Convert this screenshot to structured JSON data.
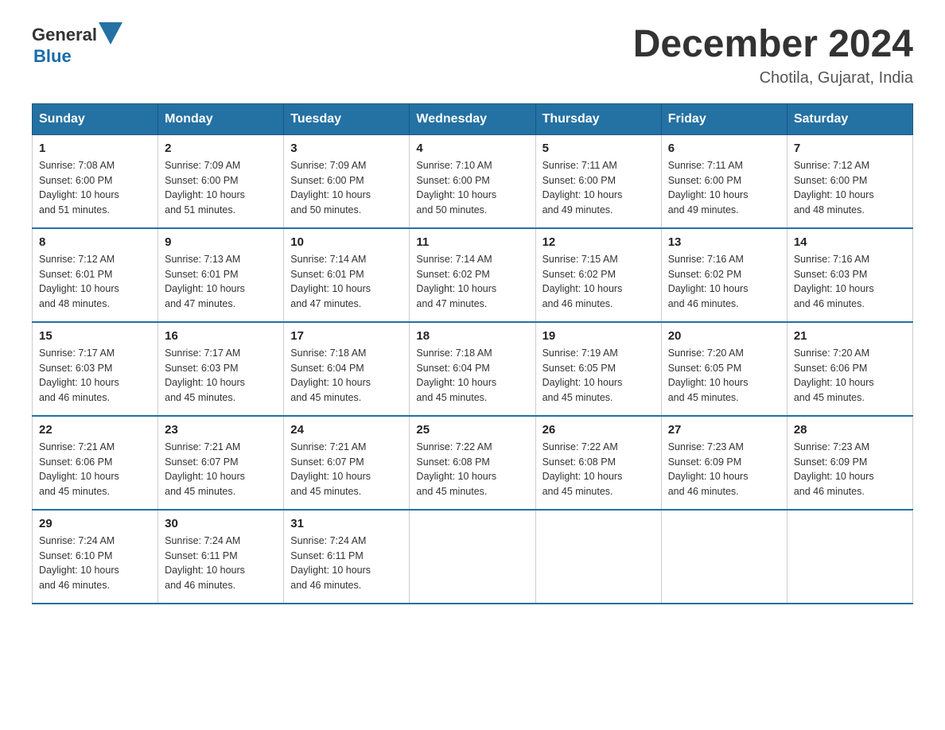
{
  "header": {
    "logo": {
      "general": "General",
      "blue": "Blue"
    },
    "title": "December 2024",
    "location": "Chotila, Gujarat, India"
  },
  "weekdays": [
    "Sunday",
    "Monday",
    "Tuesday",
    "Wednesday",
    "Thursday",
    "Friday",
    "Saturday"
  ],
  "weeks": [
    [
      {
        "day": "1",
        "sunrise": "7:08 AM",
        "sunset": "6:00 PM",
        "daylight": "10 hours and 51 minutes."
      },
      {
        "day": "2",
        "sunrise": "7:09 AM",
        "sunset": "6:00 PM",
        "daylight": "10 hours and 51 minutes."
      },
      {
        "day": "3",
        "sunrise": "7:09 AM",
        "sunset": "6:00 PM",
        "daylight": "10 hours and 50 minutes."
      },
      {
        "day": "4",
        "sunrise": "7:10 AM",
        "sunset": "6:00 PM",
        "daylight": "10 hours and 50 minutes."
      },
      {
        "day": "5",
        "sunrise": "7:11 AM",
        "sunset": "6:00 PM",
        "daylight": "10 hours and 49 minutes."
      },
      {
        "day": "6",
        "sunrise": "7:11 AM",
        "sunset": "6:00 PM",
        "daylight": "10 hours and 49 minutes."
      },
      {
        "day": "7",
        "sunrise": "7:12 AM",
        "sunset": "6:00 PM",
        "daylight": "10 hours and 48 minutes."
      }
    ],
    [
      {
        "day": "8",
        "sunrise": "7:12 AM",
        "sunset": "6:01 PM",
        "daylight": "10 hours and 48 minutes."
      },
      {
        "day": "9",
        "sunrise": "7:13 AM",
        "sunset": "6:01 PM",
        "daylight": "10 hours and 47 minutes."
      },
      {
        "day": "10",
        "sunrise": "7:14 AM",
        "sunset": "6:01 PM",
        "daylight": "10 hours and 47 minutes."
      },
      {
        "day": "11",
        "sunrise": "7:14 AM",
        "sunset": "6:02 PM",
        "daylight": "10 hours and 47 minutes."
      },
      {
        "day": "12",
        "sunrise": "7:15 AM",
        "sunset": "6:02 PM",
        "daylight": "10 hours and 46 minutes."
      },
      {
        "day": "13",
        "sunrise": "7:16 AM",
        "sunset": "6:02 PM",
        "daylight": "10 hours and 46 minutes."
      },
      {
        "day": "14",
        "sunrise": "7:16 AM",
        "sunset": "6:03 PM",
        "daylight": "10 hours and 46 minutes."
      }
    ],
    [
      {
        "day": "15",
        "sunrise": "7:17 AM",
        "sunset": "6:03 PM",
        "daylight": "10 hours and 46 minutes."
      },
      {
        "day": "16",
        "sunrise": "7:17 AM",
        "sunset": "6:03 PM",
        "daylight": "10 hours and 45 minutes."
      },
      {
        "day": "17",
        "sunrise": "7:18 AM",
        "sunset": "6:04 PM",
        "daylight": "10 hours and 45 minutes."
      },
      {
        "day": "18",
        "sunrise": "7:18 AM",
        "sunset": "6:04 PM",
        "daylight": "10 hours and 45 minutes."
      },
      {
        "day": "19",
        "sunrise": "7:19 AM",
        "sunset": "6:05 PM",
        "daylight": "10 hours and 45 minutes."
      },
      {
        "day": "20",
        "sunrise": "7:20 AM",
        "sunset": "6:05 PM",
        "daylight": "10 hours and 45 minutes."
      },
      {
        "day": "21",
        "sunrise": "7:20 AM",
        "sunset": "6:06 PM",
        "daylight": "10 hours and 45 minutes."
      }
    ],
    [
      {
        "day": "22",
        "sunrise": "7:21 AM",
        "sunset": "6:06 PM",
        "daylight": "10 hours and 45 minutes."
      },
      {
        "day": "23",
        "sunrise": "7:21 AM",
        "sunset": "6:07 PM",
        "daylight": "10 hours and 45 minutes."
      },
      {
        "day": "24",
        "sunrise": "7:21 AM",
        "sunset": "6:07 PM",
        "daylight": "10 hours and 45 minutes."
      },
      {
        "day": "25",
        "sunrise": "7:22 AM",
        "sunset": "6:08 PM",
        "daylight": "10 hours and 45 minutes."
      },
      {
        "day": "26",
        "sunrise": "7:22 AM",
        "sunset": "6:08 PM",
        "daylight": "10 hours and 45 minutes."
      },
      {
        "day": "27",
        "sunrise": "7:23 AM",
        "sunset": "6:09 PM",
        "daylight": "10 hours and 46 minutes."
      },
      {
        "day": "28",
        "sunrise": "7:23 AM",
        "sunset": "6:09 PM",
        "daylight": "10 hours and 46 minutes."
      }
    ],
    [
      {
        "day": "29",
        "sunrise": "7:24 AM",
        "sunset": "6:10 PM",
        "daylight": "10 hours and 46 minutes."
      },
      {
        "day": "30",
        "sunrise": "7:24 AM",
        "sunset": "6:11 PM",
        "daylight": "10 hours and 46 minutes."
      },
      {
        "day": "31",
        "sunrise": "7:24 AM",
        "sunset": "6:11 PM",
        "daylight": "10 hours and 46 minutes."
      },
      null,
      null,
      null,
      null
    ]
  ],
  "labels": {
    "sunrise": "Sunrise:",
    "sunset": "Sunset:",
    "daylight": "Daylight:"
  }
}
